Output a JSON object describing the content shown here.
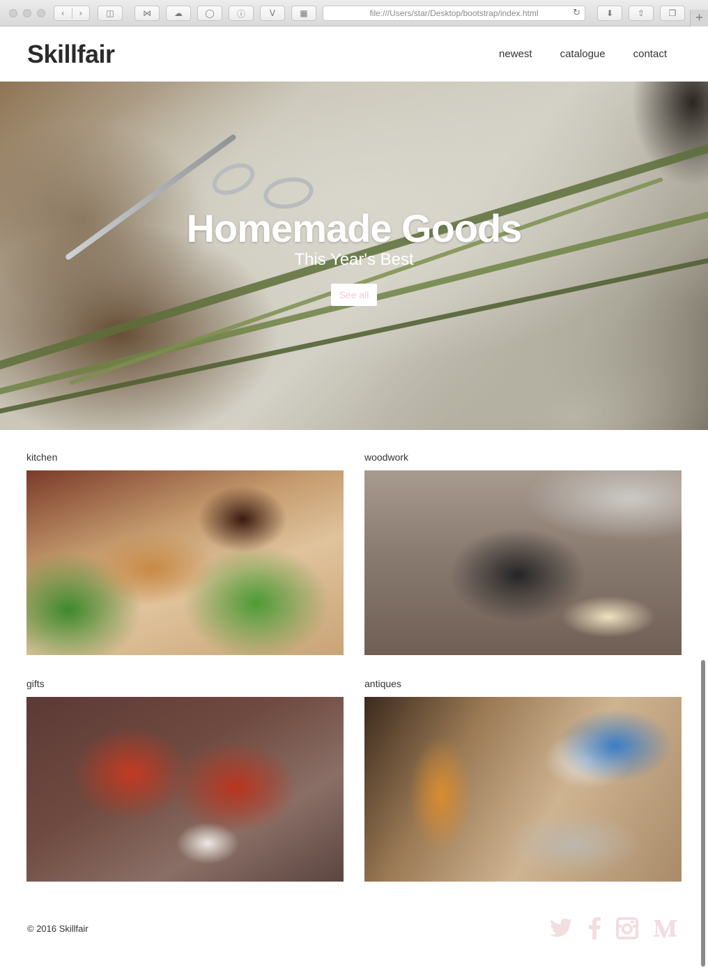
{
  "browser": {
    "url": "file:///Users/star/Desktop/bootstrap/index.html",
    "new_tab": "+"
  },
  "site": {
    "brand": "Skillfair",
    "nav": [
      {
        "label": "newest"
      },
      {
        "label": "catalogue"
      },
      {
        "label": "contact"
      }
    ]
  },
  "hero": {
    "title": "Homemade Goods",
    "subtitle": "This Year's Best",
    "button": "See all"
  },
  "categories": [
    {
      "label": "kitchen"
    },
    {
      "label": "woodwork"
    },
    {
      "label": "gifts"
    },
    {
      "label": "antiques"
    }
  ],
  "footer": {
    "copyright": "© 2016 Skillfair",
    "social": [
      "twitter-icon",
      "facebook-icon",
      "instagram-icon",
      "medium-icon"
    ],
    "icon_color": "#f2dde1"
  },
  "colors": {
    "hero_button_text": "#f7c9d3"
  }
}
